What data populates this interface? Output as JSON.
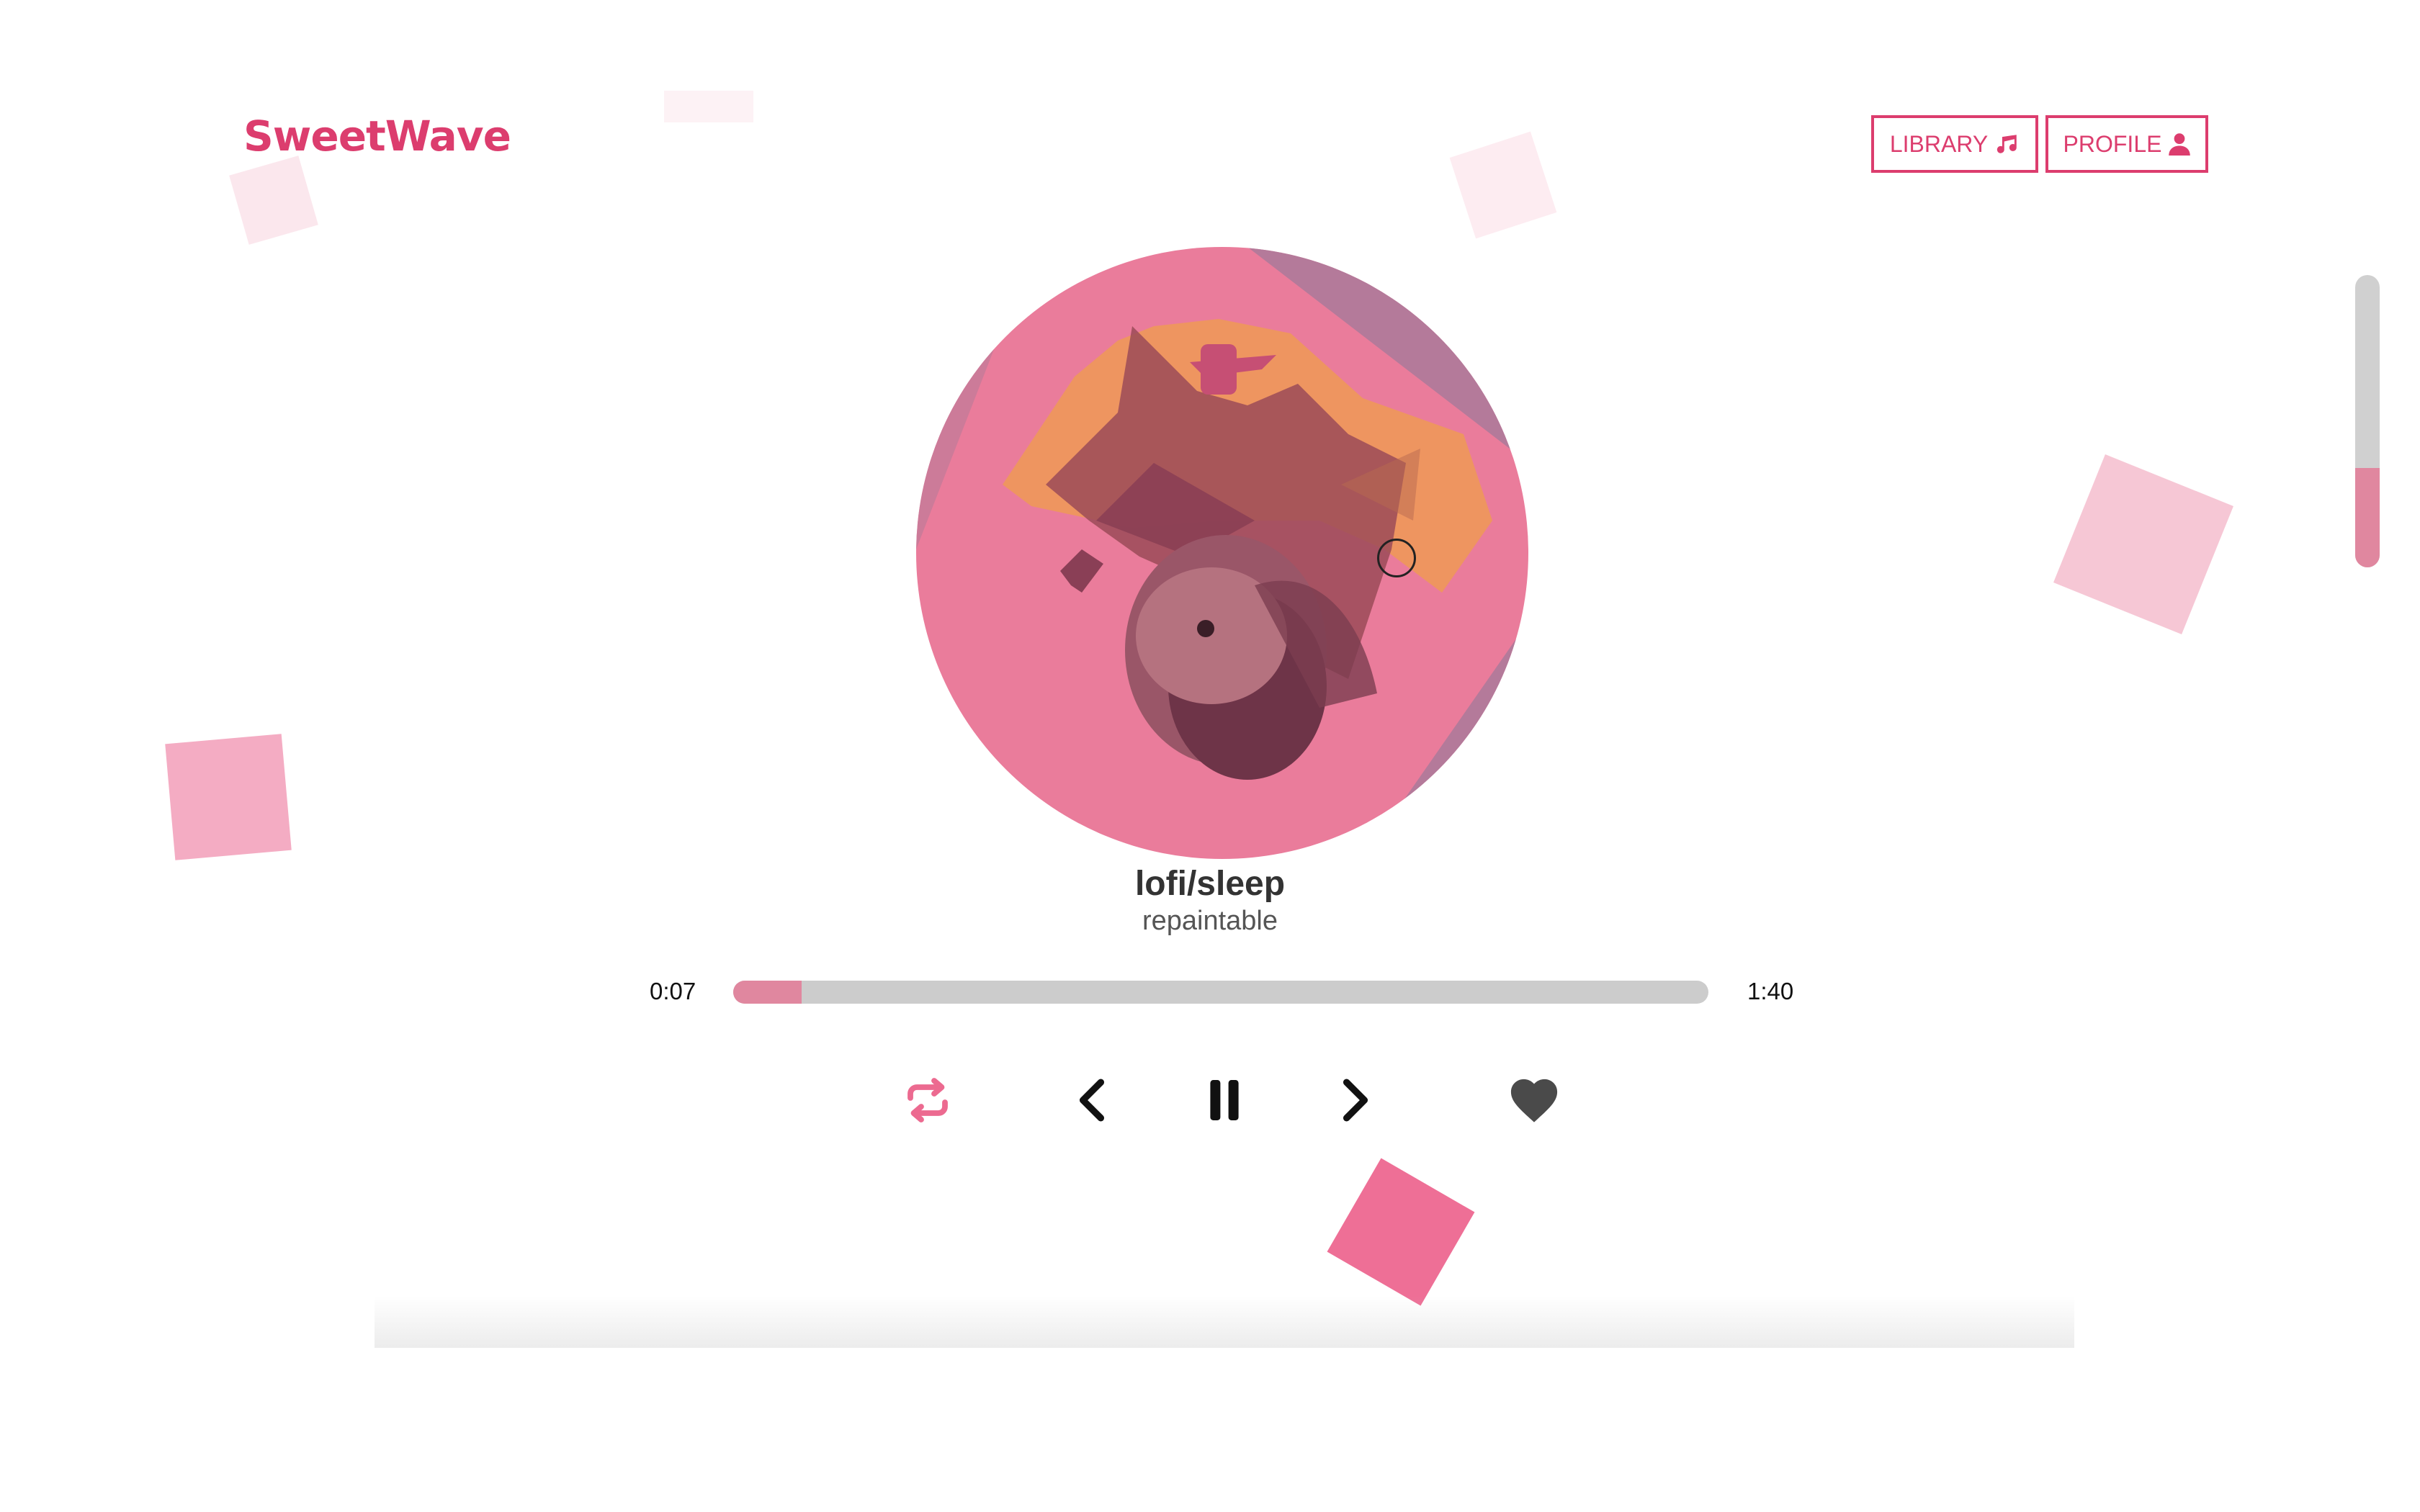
{
  "app": {
    "logo": "SweetWave",
    "brand_color": "#dc3d6e"
  },
  "nav": {
    "library_label": "LIBRARY",
    "library_icon": "music-note-icon",
    "profile_label": "PROFILE",
    "profile_icon": "user-icon"
  },
  "player": {
    "title": "lofi/sleep",
    "artist": "repaintable",
    "current_time": "0:07",
    "duration": "1:40",
    "progress_fraction": 0.07,
    "volume_fraction": 0.34
  },
  "controls": {
    "repeat_icon": "repeat-icon",
    "previous_icon": "chevron-left-icon",
    "pause_icon": "pause-icon",
    "next_icon": "chevron-right-icon",
    "like_icon": "heart-icon"
  },
  "colors": {
    "accent": "#dc3d6e",
    "progress_fill": "#e0879f",
    "track": "#cccccc"
  }
}
